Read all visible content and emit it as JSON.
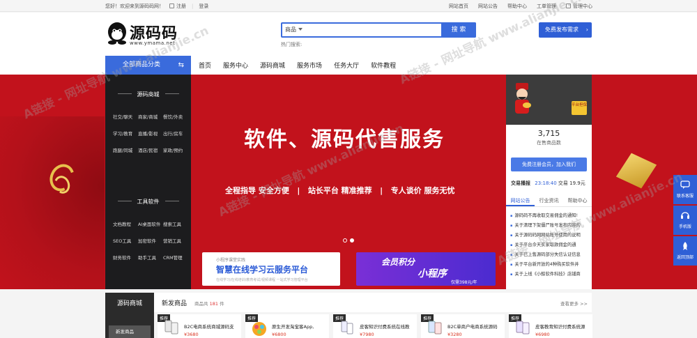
{
  "topbar": {
    "welcome": "您好！欢迎来到源码码网！",
    "register": "注册",
    "login": "登录",
    "links": [
      "网站首页",
      "网站公告",
      "帮助中心",
      "工单管理"
    ],
    "manage": "管理中心"
  },
  "header": {
    "brand": "源码码",
    "domain": "www.ymama.net",
    "search_scope": "商品",
    "search_placeholder": "",
    "search_button": "搜 索",
    "hot_label": "热门搜索:",
    "publish_button": "免费发布需求"
  },
  "nav": {
    "all_categories": "全部商品分类",
    "links": [
      "首页",
      "服务中心",
      "源码商城",
      "服务市场",
      "任务大厅",
      "软件教程"
    ]
  },
  "categories": {
    "group1_title": "源码商城",
    "group1_items": [
      "社交/聊天",
      "商家/商城",
      "餐饮/外卖",
      "学习/教育",
      "直播/影视",
      "出行/房车",
      "跑腿/同城",
      "酒店/民宿",
      "家政/预约"
    ],
    "group2_title": "工具软件",
    "group2_items": [
      "文档教程",
      "AI桌面软件",
      "搜索工具",
      "SEO工具",
      "加密软件",
      "营销工具",
      "财务软件",
      "助手工具",
      "CRM管理"
    ]
  },
  "banner": {
    "headline": "软件、源码代售服务",
    "subline": "全程指导 安全方便   |   站长平台 精准推荐   |   专人谈价 服务无忧",
    "promo1_tag": "小程序课堂实践",
    "promo1_title": "智慧在线学习云服务平台",
    "promo1_desc": "在线学习/在线培训/教育考试/视频课程 一站式学习管理平台",
    "promo2_title1": "会员积分",
    "promo2_title2": "小程序",
    "promo2_price": "仅需398元/年"
  },
  "user_panel": {
    "badge": "平台担保",
    "count": "3,715",
    "count_label": "在售商品数",
    "join_button": "免费注册会员，加入我们",
    "ticker_label": "交易播报",
    "ticker_time": "23:18:40",
    "ticker_text": "交易 19.9元",
    "tabs": [
      "网站公告",
      "行业资讯",
      "帮助中心"
    ],
    "news": [
      "源码码不再收取交易佣金的通知!",
      "关于清理下架僵尸账号发布内容的",
      "关于源码码网网站账号使用的说明",
      "关于平台今天买家取款佣金的通",
      "关于已上售源码部分失信认证信息",
      "关于平台新开放的4种购买软件并",
      "关于上线《小鲸软件科技》店铺商"
    ]
  },
  "side_tools": [
    "联系客服",
    "手机版",
    "返回顶部"
  ],
  "new_goods": {
    "side_title": "源码商城",
    "side_button": "新发商品",
    "title": "新发商品",
    "count_prefix": "商品共",
    "count": "181",
    "count_suffix": "件",
    "more": "查看更多 >>",
    "items": [
      {
        "tag": "推荐",
        "name": "B2C电商系统商城源码支",
        "price": "¥3680"
      },
      {
        "tag": "推荐",
        "name": "原生开发淘宝客App,",
        "price": "¥6800"
      },
      {
        "tag": "推荐",
        "name": "皮客知识付费系统在线教",
        "price": "¥7980"
      },
      {
        "tag": "推荐",
        "name": "B2C单商户电商系统源码",
        "price": "¥3280"
      },
      {
        "tag": "推荐",
        "name": "皮客教育知识付费系统源",
        "price": "¥6980"
      }
    ]
  },
  "colors": {
    "primary": "#3a6bdc",
    "banner": "#c2121c",
    "dark": "#1c1c1e",
    "price": "#d8321f"
  },
  "watermark": "A链接 - 网址导航 www.alianjie.cn"
}
